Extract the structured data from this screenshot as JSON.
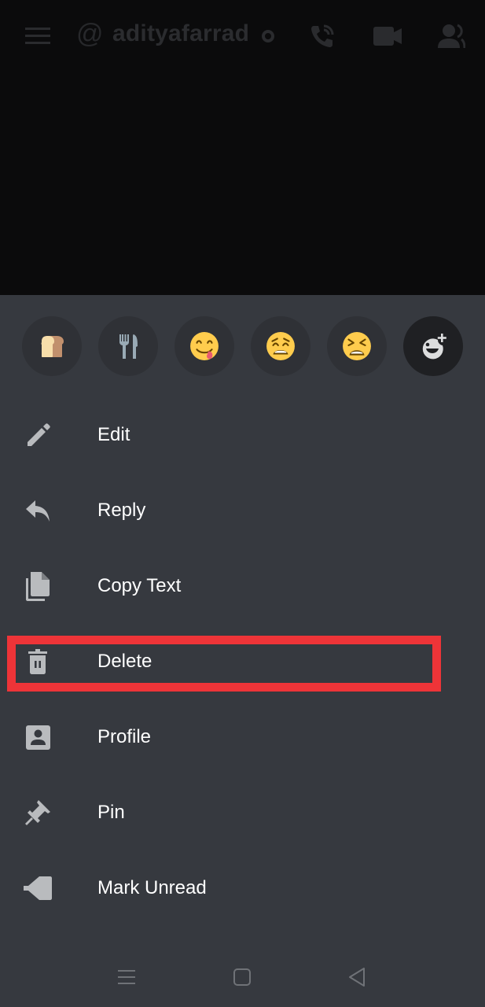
{
  "header": {
    "at_symbol": "@",
    "username": "adityafarrad",
    "icons": [
      "hamburger-menu-icon",
      "status-indicator-icon",
      "voice-call-icon",
      "video-call-icon",
      "member-list-icon"
    ]
  },
  "reactions": [
    {
      "name": "bread",
      "icon": "bread-emoji"
    },
    {
      "name": "fork_and_knife",
      "icon": "fork-knife-emoji"
    },
    {
      "name": "yum",
      "icon": "yum-emoji"
    },
    {
      "name": "weary",
      "icon": "weary-emoji"
    },
    {
      "name": "tired_face",
      "icon": "tired-face-emoji"
    },
    {
      "name": "add_reaction",
      "icon": "add-reaction-icon"
    }
  ],
  "menu": {
    "items": [
      {
        "label": "Edit",
        "icon": "pencil-icon"
      },
      {
        "label": "Reply",
        "icon": "reply-icon"
      },
      {
        "label": "Copy Text",
        "icon": "copy-icon"
      },
      {
        "label": "Delete",
        "icon": "trash-icon",
        "highlighted": true
      },
      {
        "label": "Profile",
        "icon": "profile-icon"
      },
      {
        "label": "Pin",
        "icon": "pin-icon"
      },
      {
        "label": "Mark Unread",
        "icon": "mark-unread-icon"
      }
    ]
  },
  "highlight_color": "#ee3438",
  "colors": {
    "sheet_bg": "#36393f",
    "icon": "#b9bbbe",
    "text": "#ffffff"
  },
  "navbar": {
    "buttons": [
      "recent-apps",
      "home",
      "back"
    ]
  }
}
